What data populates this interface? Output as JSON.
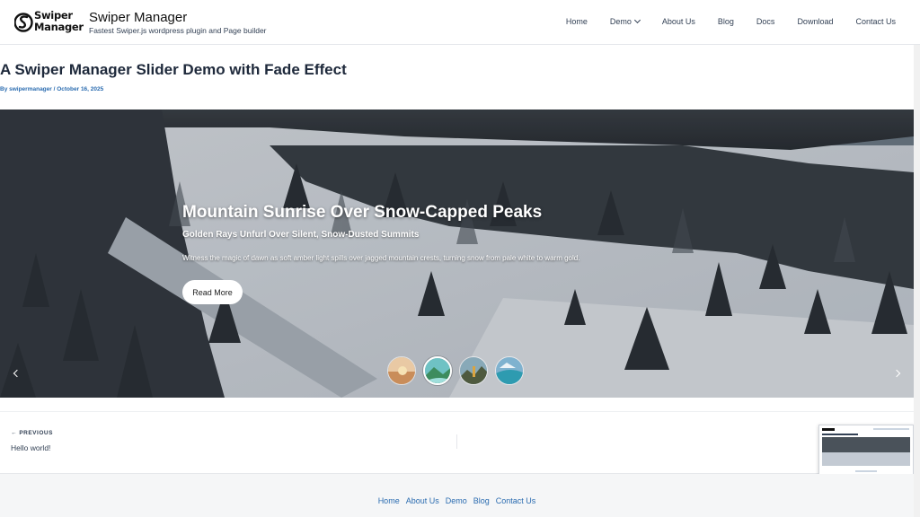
{
  "header": {
    "logo_line1": "Swiper",
    "logo_line2": "Manager",
    "site_title": "Swiper Manager",
    "tagline": "Fastest Swiper.js wordpress plugin and Page builder",
    "nav": [
      {
        "label": "Home"
      },
      {
        "label": "Demo",
        "has_dropdown": true
      },
      {
        "label": "About Us"
      },
      {
        "label": "Blog"
      },
      {
        "label": "Docs"
      },
      {
        "label": "Download"
      },
      {
        "label": "Contact Us"
      }
    ]
  },
  "post": {
    "title": "A Swiper Manager Slider Demo with Fade Effect",
    "meta": "By swipermanager / October 16, 2025"
  },
  "slider": {
    "heading": "Mountain Sunrise Over Snow-Capped Peaks",
    "subheading": "Golden Rays Unfurl Over Silent, Snow-Dusted Summits",
    "description": "Witness the magic of dawn as soft amber light spills over jagged mountain crests, turning snow from pale white to warm gold.",
    "button_label": "Read More",
    "thumbnail_count": 4,
    "active_thumbnail": 2
  },
  "post_nav": {
    "prev_label": "PREVIOUS",
    "prev_title": "Hello world!"
  },
  "footer": {
    "links": [
      "Home",
      "About Us",
      "Demo",
      "Blog",
      "Contact Us"
    ]
  },
  "colors": {
    "link": "#2b6cb0",
    "text": "#1e293b"
  }
}
